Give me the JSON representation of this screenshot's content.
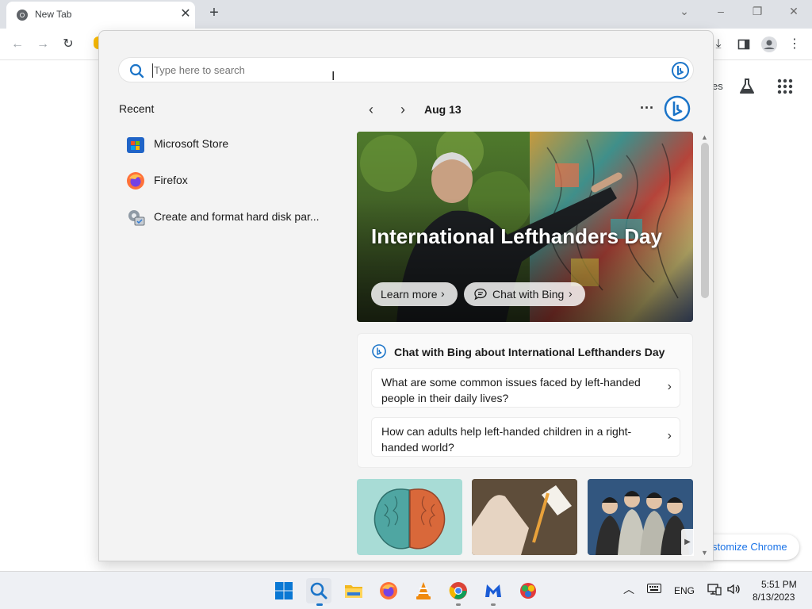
{
  "browser": {
    "tab_title": "New Tab",
    "tab_close_icon": "close-icon",
    "new_tab_icon": "plus-icon",
    "partial_ntp_text": "es",
    "customize_button": "stomize Chrome"
  },
  "search": {
    "placeholder": "Type here to search"
  },
  "recent": {
    "title": "Recent",
    "items": [
      {
        "label": "Microsoft Store",
        "icon": "microsoft-store-icon"
      },
      {
        "label": "Firefox",
        "icon": "firefox-icon"
      },
      {
        "label": "Create and format hard disk par...",
        "icon": "disk-management-icon"
      }
    ]
  },
  "highlights": {
    "date": "Aug 13",
    "hero": {
      "title": "International Lefthanders Day",
      "learn_more": "Learn more",
      "chat_with_bing": "Chat with Bing"
    },
    "chat_card": {
      "heading": "Chat with Bing about International Lefthanders Day",
      "questions": [
        "What are some common issues faced by left-handed people in their daily lives?",
        "How can adults help left-handed children in a right-handed world?"
      ]
    }
  },
  "taskbar": {
    "language": "ENG",
    "time": "5:51 PM",
    "date": "8/13/2023"
  },
  "colors": {
    "accent": "#1a73e8",
    "bing": "#1b74c8",
    "flyout_bg": "#f3f3f3"
  }
}
